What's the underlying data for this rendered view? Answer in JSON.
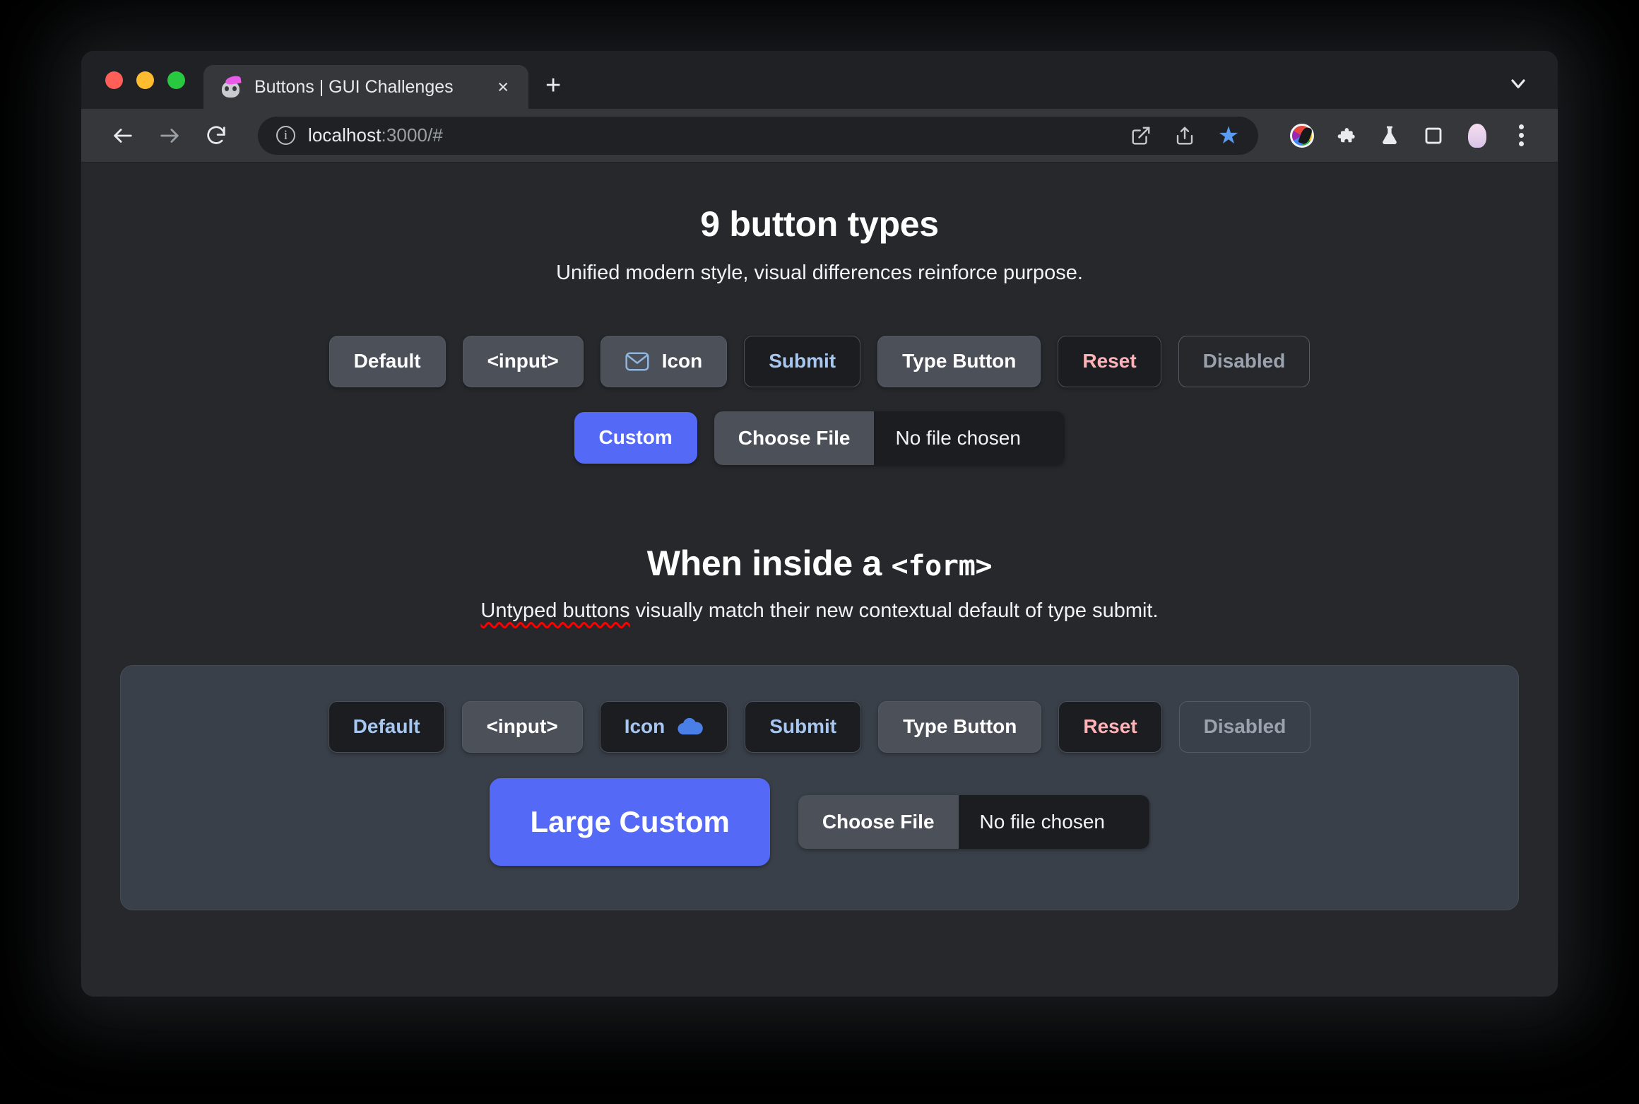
{
  "browser": {
    "tab": {
      "title": "Buttons | GUI Challenges",
      "favicon": "skull-party-hat-icon",
      "close": "×"
    },
    "new_tab_label": "+",
    "tabstrip_chevron": "chevron-down-icon",
    "omnibox": {
      "info_icon": "ⓘ",
      "url_host": "localhost",
      "url_path": ":3000/#",
      "actions": [
        "open-in-new-icon",
        "share-icon",
        "bookmark-star-icon"
      ]
    },
    "extensions": [
      "color-wheel-icon",
      "puzzle-piece-icon",
      "flask-icon",
      "side-panel-icon",
      "profile-avatar-icon",
      "kebab-menu-icon"
    ],
    "nav": {
      "back": "←",
      "forward": "→",
      "reload": "↻"
    }
  },
  "page": {
    "heading": "9 button types",
    "subheading": "Unified modern style, visual differences reinforce purpose.",
    "form_heading_prefix": "When inside a ",
    "form_heading_code": "<form>",
    "form_sub_spell": "Untyped buttons",
    "form_sub_rest": " visually match their new contextual default of type submit.",
    "buttons_row1": [
      {
        "label": "Default",
        "style": "grey",
        "icon": null
      },
      {
        "label": "<input>",
        "style": "grey",
        "icon": null
      },
      {
        "label": "Icon",
        "style": "grey",
        "icon": "mail-icon",
        "icon_side": "left"
      },
      {
        "label": "Submit",
        "style": "submit",
        "icon": null
      },
      {
        "label": "Type Button",
        "style": "grey",
        "icon": null
      },
      {
        "label": "Reset",
        "style": "reset",
        "icon": null
      },
      {
        "label": "Disabled",
        "style": "disabled",
        "icon": null
      }
    ],
    "custom_label": "Custom",
    "file_button_label": "Choose File",
    "file_status_label": "No file chosen",
    "buttons_row2": [
      {
        "label": "Default",
        "style": "submit",
        "icon": null
      },
      {
        "label": "<input>",
        "style": "grey",
        "icon": null
      },
      {
        "label": "Icon",
        "style": "submit",
        "icon": "cloud-icon",
        "icon_side": "right"
      },
      {
        "label": "Submit",
        "style": "submit",
        "icon": null
      },
      {
        "label": "Type Button",
        "style": "grey",
        "icon": null
      },
      {
        "label": "Reset",
        "style": "reset",
        "icon": null
      },
      {
        "label": "Disabled",
        "style": "disabled",
        "icon": null
      }
    ],
    "large_custom_label": "Large Custom",
    "file_button_label2": "Choose File",
    "file_status_label2": "No file chosen"
  },
  "colors": {
    "page_bg": "#26282c",
    "button_grey": "#4b5059",
    "button_dark": "#1b1d21",
    "accent_blue": "#5469f5",
    "submit_text": "#a8c7f0",
    "reset_text": "#ffb3b8",
    "form_bg": "#3a4049"
  }
}
